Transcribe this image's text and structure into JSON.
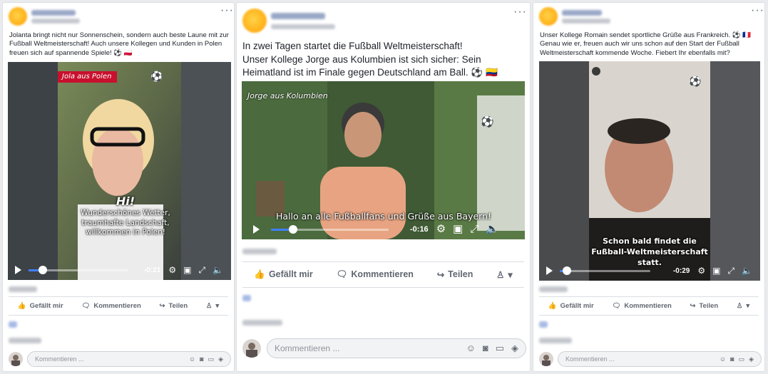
{
  "posts": [
    {
      "text": "Jolanta bringt nicht nur Sonnenschein, sondern auch beste Laune mit zur Fußball Weltmeisterschaft! Auch unsere Kollegen und Kunden in Polen freuen sich auf spannende Spiele! ⚽ 🇵🇱",
      "video": {
        "banner": "Jola aus Polen",
        "overlay_title": "Hi!",
        "overlay_text": "Wunderschönes Wetter,\ntraumhafte Landschaft,\nwillkommen in Polen!",
        "time": "-0:21",
        "progress": 0.14
      },
      "actions": {
        "like": "Gefällt mir",
        "comment": "Kommentieren",
        "share": "Teilen"
      },
      "comment_placeholder": "Kommentieren ..."
    },
    {
      "text": "In zwei Tagen startet die Fußball Weltmeisterschaft!\nUnser Kollege Jorge aus Kolumbien ist sich sicher: Sein Heimatland ist im Finale gegen Deutschland am Ball. ⚽ 🇨🇴",
      "video": {
        "banner": "Jorge aus Kolumbien",
        "subtitle": "Hallo an alle Fußballfans und Grüße aus Bayern!",
        "time": "-0:16",
        "progress": 0.19
      },
      "actions": {
        "like": "Gefällt mir",
        "comment": "Kommentieren",
        "share": "Teilen"
      },
      "comment_placeholder": "Kommentieren ..."
    },
    {
      "text": "Unser Kollege Romain sendet sportliche Grüße aus Frankreich. ⚽ 🇫🇷\nGenau wie er, freuen auch wir uns schon auf den Start der Fußball Weltmeisterschaft kommende Woche. Fiebert Ihr ebenfalls mit?",
      "video": {
        "subtitle": "Schon bald findet die\nFußball-Weltmeisterschaft\nstatt.",
        "time": "-0:29",
        "progress": 0.08
      },
      "actions": {
        "like": "Gefällt mir",
        "comment": "Kommentieren",
        "share": "Teilen"
      },
      "comment_placeholder": "Kommentieren ..."
    }
  ],
  "icons": {
    "more": "more-options-icon",
    "like": "thumbs-up-icon",
    "comment": "speech-bubble-icon",
    "share": "share-arrow-icon",
    "emoji": "emoji-icon",
    "camera": "camera-icon",
    "gif": "gif-icon",
    "sticker": "sticker-icon"
  },
  "colors": {
    "accent": "#4080ff",
    "banner_red": "#c8102e",
    "background": "#e9ebee"
  }
}
